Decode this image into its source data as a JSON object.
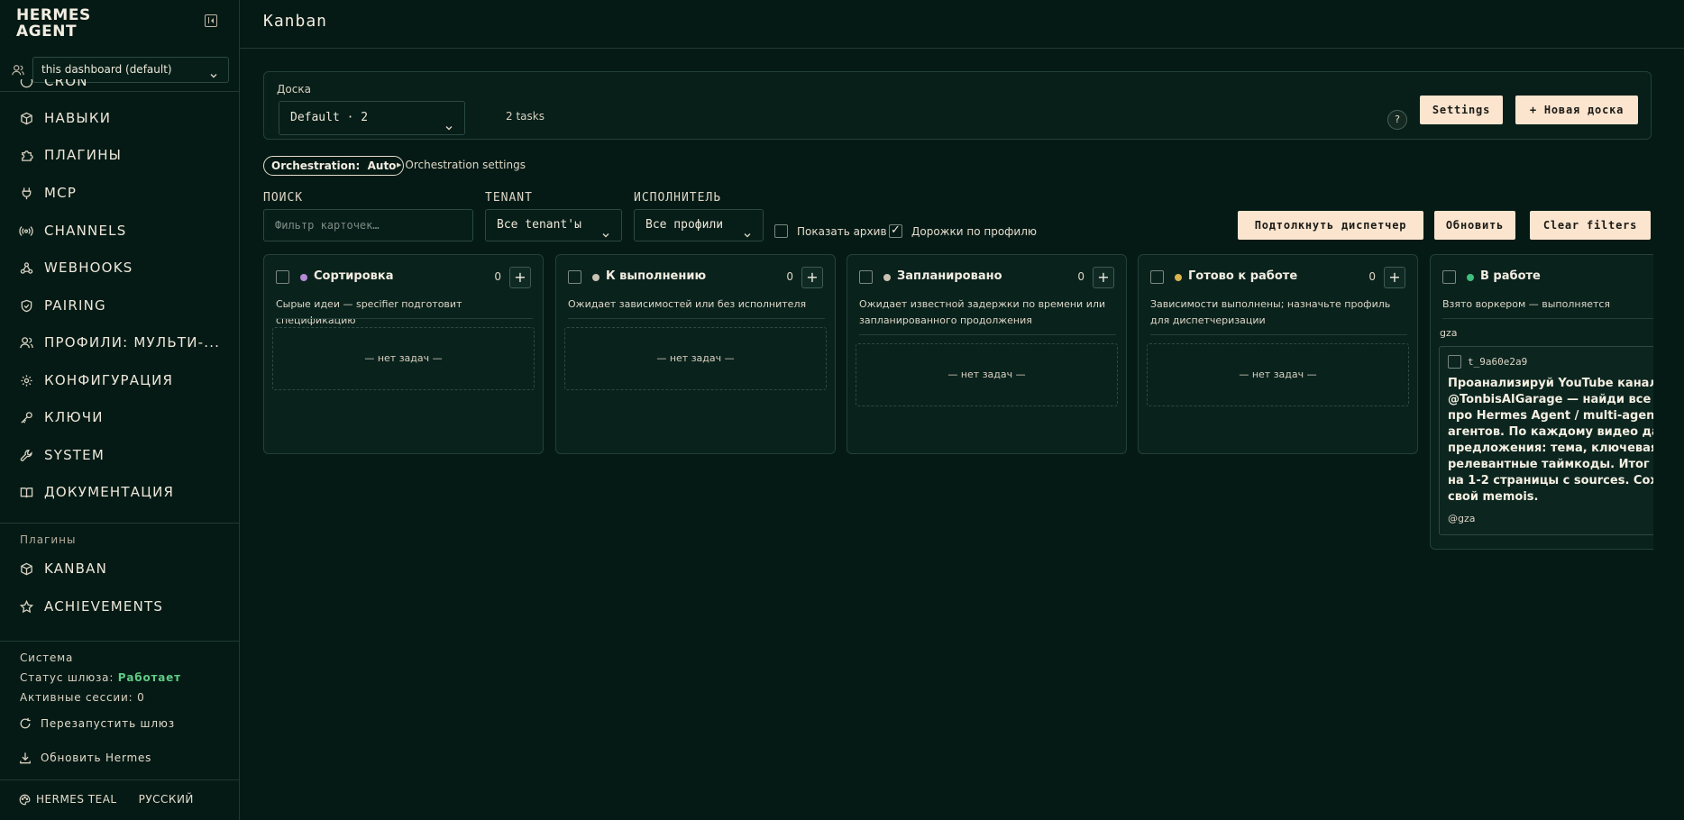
{
  "brand": {
    "line1": "HERMES",
    "line2": "AGENT"
  },
  "profile_select": {
    "value": "this dashboard (default)"
  },
  "nav": {
    "cut_item": "CRON",
    "items": [
      {
        "label": "НАВЫКИ",
        "icon": "package-icon"
      },
      {
        "label": "ПЛАГИНЫ",
        "icon": "puzzle-icon"
      },
      {
        "label": "MCP",
        "icon": "plug-icon"
      },
      {
        "label": "CHANNELS",
        "icon": "broadcast-icon"
      },
      {
        "label": "WEBHOOKS",
        "icon": "webhook-icon"
      },
      {
        "label": "PAIRING",
        "icon": "shield-icon"
      },
      {
        "label": "ПРОФИЛИ: МУЛЬТИ-...",
        "icon": "users-icon"
      },
      {
        "label": "КОНФИГУРАЦИЯ",
        "icon": "gear-icon"
      },
      {
        "label": "КЛЮЧИ",
        "icon": "key-icon"
      },
      {
        "label": "SYSTEM",
        "icon": "wrench-icon"
      },
      {
        "label": "ДОКУМЕНТАЦИЯ",
        "icon": "book-icon"
      }
    ],
    "plugins_label": "Плагины",
    "plugin_items": [
      {
        "label": "KANBAN",
        "icon": "package-icon"
      },
      {
        "label": "ACHIEVEMENTS",
        "icon": "star-icon"
      }
    ]
  },
  "system": {
    "label": "Система",
    "gateway_status_label": "Статус шлюза:",
    "gateway_status_value": "Работает",
    "sessions_label": "Активные сессии:",
    "sessions_value": "0",
    "restart_label": "Перезапустить шлюз",
    "update_label": "Обновить Hermes"
  },
  "footer": {
    "theme": "HERMES TEAL",
    "language": "РУССКИЙ"
  },
  "page": {
    "title": "Kanban"
  },
  "board": {
    "label": "Доска",
    "selected": "Default · 2",
    "count": "2 tasks",
    "help": "?",
    "settings_label": "Settings",
    "new_board_label": "+ Новая доска"
  },
  "orchestration": {
    "pill_label": "Orchestration:",
    "pill_value": "Auto",
    "settings_link": "Orchestration settings"
  },
  "filters": {
    "search_label": "ПОИСК",
    "search_placeholder": "Фильтр карточек…",
    "tenant_label": "TENANT",
    "tenant_value": "Все tenant'ы",
    "assignee_label": "ИСПОЛНИТЕЛЬ",
    "assignee_value": "Все профили",
    "show_archive": "Показать архив",
    "show_archive_checked": false,
    "lanes_by_profile": "Дорожки по профилю",
    "lanes_by_profile_checked": true,
    "nudge_label": "Подтолкнуть диспетчер",
    "refresh_label": "Обновить",
    "clear_label": "Clear filters"
  },
  "columns": [
    {
      "title": "Сортировка",
      "count": "0",
      "dot_color": "#b58ad6",
      "desc": "Сырые идеи — specifier подготовит спецификацию",
      "empty": "— нет задач —"
    },
    {
      "title": "К выполнению",
      "count": "0",
      "dot_color": "#c9c2b3",
      "desc": "Ожидает зависимостей или без исполнителя",
      "empty": "— нет задач —"
    },
    {
      "title": "Запланировано",
      "count": "0",
      "dot_color": "#c9c2b3",
      "desc": "Ожидает известной задержки по времени или запланированного продолжения",
      "empty": "— нет задач —"
    },
    {
      "title": "Готово к работе",
      "count": "0",
      "dot_color": "#d9b44f",
      "desc": "Зависимости выполнены; назначьте профиль для диспетчеризации",
      "empty": "— нет задач —"
    },
    {
      "title": "В работе",
      "dot_color": "#3fbf7f",
      "desc": "Взято воркером — выполняется",
      "group": "gza",
      "task": {
        "id": "t_9a60e2a9",
        "text": "Проанализируй YouTube канал\n@TonbisAIGarage — найди все вид\nпро Hermes Agent / multi-agent /\nагентов. По каждому видео дай 2-\nпредложения: тема, ключевая иде\nрелевантные таймкоды. Итог — п\nна 1-2 страницы с sources. Сохран\nсвой memois.",
        "user": "@gza"
      }
    }
  ]
}
